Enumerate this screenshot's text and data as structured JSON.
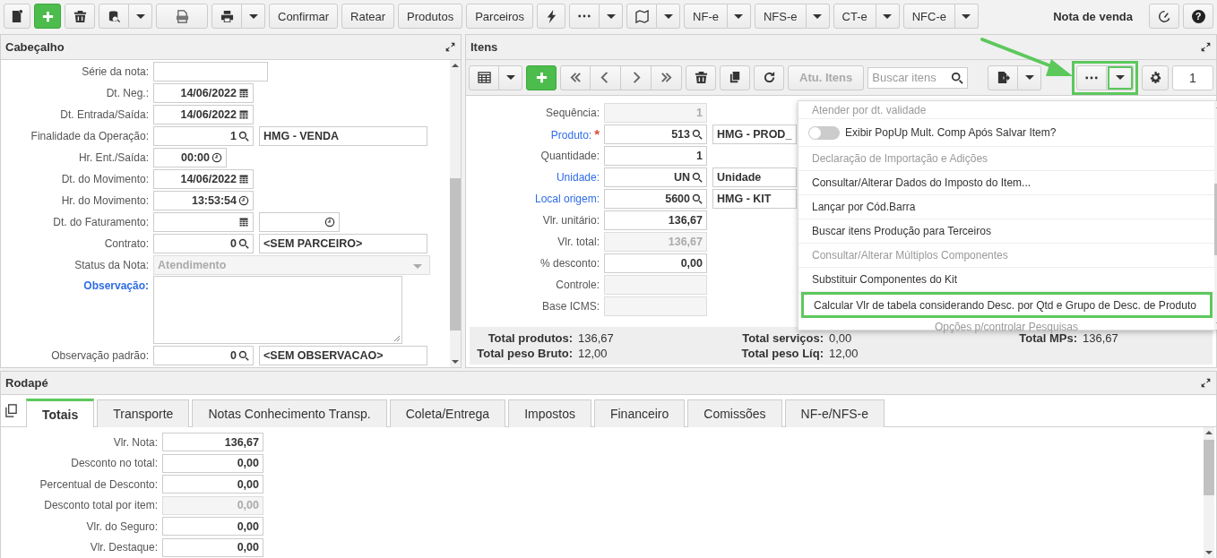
{
  "toolbar": {
    "buttons": [
      "Confirmar",
      "Ratear",
      "Produtos",
      "Parceiros"
    ],
    "document_types": [
      "NF-e",
      "NFS-e",
      "CT-e",
      "NFC-e"
    ],
    "title": "Nota de venda",
    "help_label": "?"
  },
  "header": {
    "title": "Cabeçalho",
    "rows": [
      {
        "label": "Série da nota:",
        "link": false,
        "fields": [
          {
            "kind": "text",
            "disabled": false
          }
        ]
      },
      {
        "label": "Dt. Neg.:",
        "link": false,
        "fields": [
          {
            "kind": "date",
            "value": "14/06/2022",
            "disabled": false
          }
        ]
      },
      {
        "label": "Dt. Entrada/Saída:",
        "link": false,
        "fields": [
          {
            "kind": "date",
            "value": "14/06/2022",
            "disabled": false
          }
        ]
      },
      {
        "label": "Finalidade da Operação:",
        "link": false,
        "fields": [
          {
            "kind": "lookup",
            "value": "1",
            "disabled": false
          },
          {
            "kind": "desc",
            "value": "HMG - VENDA",
            "disabled": false
          }
        ]
      },
      {
        "label": "Hr. Ent./Saída:",
        "link": false,
        "fields": [
          {
            "kind": "time",
            "value": "00:00",
            "disabled": false
          }
        ]
      },
      {
        "label": "Dt. do Movimento:",
        "link": false,
        "fields": [
          {
            "kind": "date",
            "value": "14/06/2022",
            "disabled": false
          }
        ]
      },
      {
        "label": "Hr. do Movimento:",
        "link": false,
        "fields": [
          {
            "kind": "time",
            "value": "13:53:54",
            "disabled": false
          }
        ]
      },
      {
        "label": "Dt. do Faturamento:",
        "link": false,
        "fields": [
          {
            "kind": "date",
            "disabled": false
          },
          {
            "kind": "time",
            "disabled": false
          }
        ]
      },
      {
        "label": "Contrato:",
        "link": false,
        "fields": [
          {
            "kind": "lookup",
            "value": "0",
            "disabled": false
          },
          {
            "kind": "desc",
            "value": "<SEM PARCEIRO>",
            "disabled": false
          }
        ]
      },
      {
        "label": "Status da Nota:",
        "link": false,
        "fields": [
          {
            "kind": "select",
            "value": "Atendimento",
            "disabled": true
          }
        ]
      },
      {
        "label": "Observação:",
        "link": true,
        "fields": [
          {
            "kind": "textarea",
            "disabled": false
          }
        ]
      },
      {
        "label": "Observação padrão:",
        "link": false,
        "fields": [
          {
            "kind": "lookup",
            "value": "0",
            "disabled": false
          },
          {
            "kind": "desc",
            "value": "<SEM OBSERVACAO>",
            "disabled": false
          }
        ]
      }
    ]
  },
  "items": {
    "title": "Itens",
    "toolbar": {
      "update_button": {
        "label": "Atu. Itens",
        "disabled": true
      },
      "search": {
        "placeholder": "Buscar itens"
      },
      "more_highlighted": true,
      "page": "1"
    },
    "rows": [
      {
        "label": "Sequência:",
        "link": false,
        "fields": [
          {
            "kind": "text",
            "value": "1",
            "disabled": true
          }
        ]
      },
      {
        "label": "Produto:",
        "link": true,
        "required_mark": "*",
        "fields": [
          {
            "kind": "lookup",
            "value": "513",
            "disabled": false
          },
          {
            "kind": "desc",
            "value": "HMG - PROD_",
            "disabled": false
          }
        ]
      },
      {
        "label": "Quantidade:",
        "link": false,
        "fields": [
          {
            "kind": "text",
            "value": "1",
            "disabled": false
          }
        ]
      },
      {
        "label": "Unidade:",
        "link": true,
        "fields": [
          {
            "kind": "lookup",
            "value": "UN",
            "disabled": false
          },
          {
            "kind": "desc",
            "value": "Unidade",
            "disabled": false
          }
        ]
      },
      {
        "label": "Local origem:",
        "link": true,
        "fields": [
          {
            "kind": "lookup",
            "value": "5600",
            "disabled": false
          },
          {
            "kind": "desc",
            "value": "HMG - KIT",
            "disabled": false
          }
        ]
      },
      {
        "label": "Vlr. unitário:",
        "link": false,
        "fields": [
          {
            "kind": "text",
            "value": "136,67",
            "disabled": false
          }
        ]
      },
      {
        "label": "Vlr. total:",
        "link": false,
        "fields": [
          {
            "kind": "text",
            "value": "136,67",
            "disabled": true
          }
        ]
      },
      {
        "label": "% desconto:",
        "link": false,
        "fields": [
          {
            "kind": "text",
            "value": "0,00",
            "disabled": false
          }
        ]
      },
      {
        "label": "Controle:",
        "link": false,
        "fields": [
          {
            "kind": "text",
            "disabled": true
          }
        ]
      },
      {
        "label": "Base ICMS:",
        "link": false,
        "fields": [
          {
            "kind": "text",
            "disabled": true
          }
        ]
      }
    ],
    "totals": [
      {
        "label": "Total produtos:",
        "value": "136,67"
      },
      {
        "label": "Total serviços:",
        "value": "0,00"
      },
      {
        "label": "Total MPs:",
        "value": "136,67"
      },
      {
        "label": "Total peso Bruto:",
        "value": "12,00"
      },
      {
        "label": "Total peso Líq:",
        "value": "12,00"
      }
    ],
    "menu": [
      {
        "kind": "action",
        "label": "Atender por dt. validade",
        "disabled": true,
        "highlighted": false
      },
      {
        "kind": "toggle",
        "label": "Exibir PopUp Mult. Comp Após Salvar Item?",
        "on": false,
        "disabled": false,
        "highlighted": false
      },
      {
        "kind": "action",
        "label": "Declaração de Importação e Adições",
        "disabled": true,
        "highlighted": false
      },
      {
        "kind": "action",
        "label": "Consultar/Alterar Dados do Imposto do Item...",
        "disabled": false,
        "highlighted": false
      },
      {
        "kind": "action",
        "label": "Lançar por Cód.Barra",
        "disabled": false,
        "highlighted": false
      },
      {
        "kind": "action",
        "label": "Buscar itens Produção para Terceiros",
        "disabled": false,
        "highlighted": false
      },
      {
        "kind": "action",
        "label": "Consultar/Alterar Múltiplos Componentes",
        "disabled": true,
        "highlighted": false
      },
      {
        "kind": "action",
        "label": "Substituir Componentes do Kit",
        "disabled": false,
        "highlighted": false
      },
      {
        "kind": "action",
        "label": "Calcular Vlr de tabela considerando Desc. por Qtd e Grupo de Desc. de Produto",
        "disabled": false,
        "highlighted": true
      },
      {
        "kind": "action",
        "label": "Opções p/controlar Pesquisas",
        "disabled": true,
        "highlighted": false
      }
    ]
  },
  "footer": {
    "title": "Rodapé",
    "tabs": [
      {
        "label": "Totais",
        "selected": true
      },
      {
        "label": "Transporte",
        "selected": false
      },
      {
        "label": "Notas Conhecimento Transp.",
        "selected": false
      },
      {
        "label": "Coleta/Entrega",
        "selected": false
      },
      {
        "label": "Impostos",
        "selected": false
      },
      {
        "label": "Financeiro",
        "selected": false
      },
      {
        "label": "Comissões",
        "selected": false
      },
      {
        "label": "NF-e/NFS-e",
        "selected": false
      }
    ],
    "rows": [
      {
        "label": "Vlr. Nota:",
        "link": false,
        "fields": [
          {
            "kind": "text",
            "value": "136,67",
            "disabled": false
          }
        ]
      },
      {
        "label": "Desconto no total:",
        "link": false,
        "fields": [
          {
            "kind": "text",
            "value": "0,00",
            "disabled": false
          }
        ]
      },
      {
        "label": "Percentual de Desconto:",
        "link": false,
        "fields": [
          {
            "kind": "text",
            "value": "0,00",
            "disabled": false
          }
        ]
      },
      {
        "label": "Desconto total por item:",
        "link": false,
        "fields": [
          {
            "kind": "text",
            "value": "0,00",
            "disabled": true
          }
        ]
      },
      {
        "label": "Vlr. do Seguro:",
        "link": false,
        "fields": [
          {
            "kind": "text",
            "value": "0,00",
            "disabled": false
          }
        ]
      },
      {
        "label": "Vlr. Destaque:",
        "link": false,
        "fields": [
          {
            "kind": "text",
            "value": "0,00",
            "disabled": false
          }
        ]
      }
    ]
  }
}
